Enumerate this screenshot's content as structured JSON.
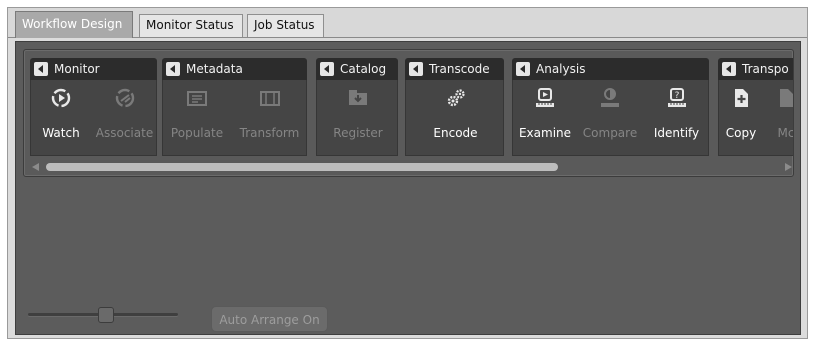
{
  "tabs": [
    {
      "label": "Workflow Design",
      "active": true
    },
    {
      "label": "Monitor Status",
      "active": false
    },
    {
      "label": "Job Status",
      "active": false
    }
  ],
  "groups": {
    "monitor": {
      "title": "Monitor",
      "tools": [
        {
          "label": "Watch",
          "icon": "watch-icon",
          "enabled": true
        },
        {
          "label": "Associate",
          "icon": "associate-icon",
          "enabled": false
        }
      ]
    },
    "metadata": {
      "title": "Metadata",
      "tools": [
        {
          "label": "Populate",
          "icon": "populate-icon",
          "enabled": false
        },
        {
          "label": "Transform",
          "icon": "transform-icon",
          "enabled": false
        }
      ]
    },
    "catalog": {
      "title": "Catalog",
      "tools": [
        {
          "label": "Register",
          "icon": "register-icon",
          "enabled": false
        }
      ]
    },
    "transcode": {
      "title": "Transcode",
      "tools": [
        {
          "label": "Encode",
          "icon": "encode-gears-icon",
          "enabled": true
        }
      ]
    },
    "analysis": {
      "title": "Analysis",
      "tools": [
        {
          "label": "Examine",
          "icon": "examine-icon",
          "enabled": true
        },
        {
          "label": "Compare",
          "icon": "compare-icon",
          "enabled": false
        },
        {
          "label": "Identify",
          "icon": "identify-icon",
          "enabled": true
        }
      ]
    },
    "transport": {
      "title": "Transpo",
      "tools": [
        {
          "label": "Copy",
          "icon": "copy-icon",
          "enabled": true
        },
        {
          "label": "Mc",
          "icon": "move-icon",
          "enabled": false
        }
      ]
    }
  },
  "zoom_slider": {
    "value_fraction": 0.52
  },
  "auto_arrange_label": "Auto Arrange On",
  "colors": {
    "panel": "#5c5c5c",
    "group_header": "#2c2c2c",
    "enabled_text": "#ffffff",
    "disabled_text": "#858585"
  }
}
